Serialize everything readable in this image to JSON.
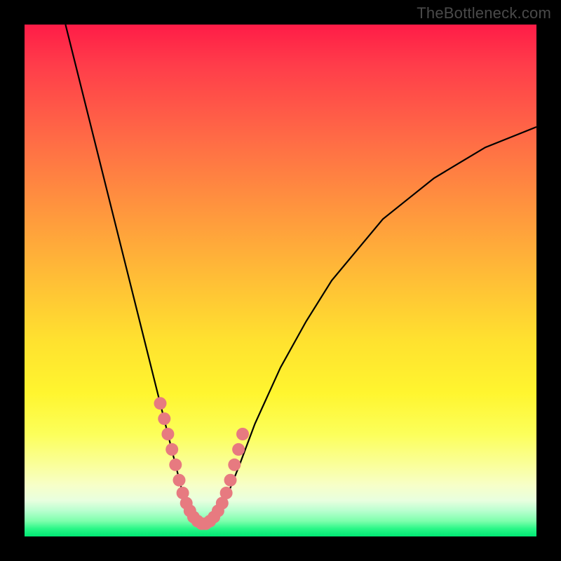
{
  "watermark": "TheBottleneck.com",
  "chart_data": {
    "type": "line",
    "title": "",
    "xlabel": "",
    "ylabel": "",
    "xlim": [
      0,
      100
    ],
    "ylim": [
      0,
      100
    ],
    "series": [
      {
        "name": "bottleneck-curve",
        "x": [
          8,
          10,
          12,
          14,
          16,
          18,
          20,
          22,
          24,
          26,
          28,
          30,
          31,
          32,
          33,
          34,
          35,
          36,
          37,
          38,
          40,
          42,
          45,
          50,
          55,
          60,
          65,
          70,
          75,
          80,
          85,
          90,
          95,
          100
        ],
        "y": [
          100,
          92,
          84,
          76,
          68,
          60,
          52,
          44,
          36,
          28,
          20,
          12,
          8,
          5,
          3,
          2,
          2,
          2,
          3,
          5,
          9,
          14,
          22,
          33,
          42,
          50,
          56,
          62,
          66,
          70,
          73,
          76,
          78,
          80
        ]
      }
    ],
    "markers": {
      "name": "highlight-dots",
      "color": "#e77a80",
      "points_x": [
        26.5,
        27.3,
        28.0,
        28.8,
        29.5,
        30.2,
        30.9,
        31.6,
        32.3,
        33.0,
        33.8,
        34.6,
        35.4,
        36.2,
        37.0,
        37.8,
        38.6,
        39.4,
        40.2,
        41.0,
        41.8,
        42.6
      ],
      "points_y": [
        26,
        23,
        20,
        17,
        14,
        11,
        8.5,
        6.5,
        5,
        3.8,
        3,
        2.5,
        2.5,
        3,
        3.8,
        5,
        6.5,
        8.5,
        11,
        14,
        17,
        20
      ]
    }
  }
}
